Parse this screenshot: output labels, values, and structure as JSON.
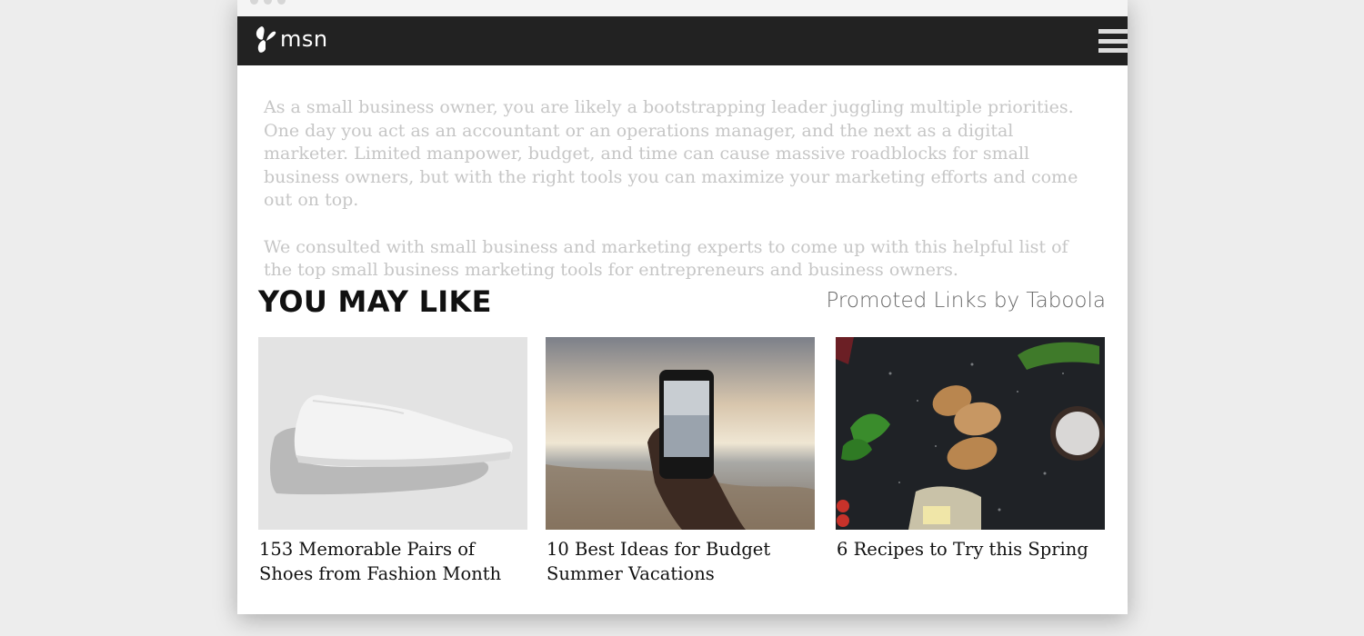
{
  "header": {
    "logo_text": "msn",
    "logo_icon": "butterfly-icon",
    "menu_icon": "hamburger-menu-icon"
  },
  "article": {
    "paragraphs": [
      "As a small business owner, you are likely a bootstrapping leader juggling multiple priorities. One day you act as an accountant or an operations manager, and the next as a digital marketer. Limited manpower, budget, and time can cause massive roadblocks for small business owners, but with the right tools you can maximize your marketing efforts and come out on top.",
      "We consulted with small business and marketing experts to come up with this helpful list of the top small business marketing tools for entrepreneurs and business owners."
    ]
  },
  "recommendations": {
    "title": "YOU MAY LIKE",
    "promoted_label": "Promoted Links by Taboola",
    "items": [
      {
        "title": "153 Memorable Pairs of Shoes from Fashion Month"
      },
      {
        "title": "10 Best Ideas for Budget Summer Vacations"
      },
      {
        "title": "6 Recipes to Try this Spring"
      }
    ]
  },
  "colors": {
    "navbar": "#222222",
    "page_background": "#ededed",
    "article_text": "#c6c6c6"
  }
}
